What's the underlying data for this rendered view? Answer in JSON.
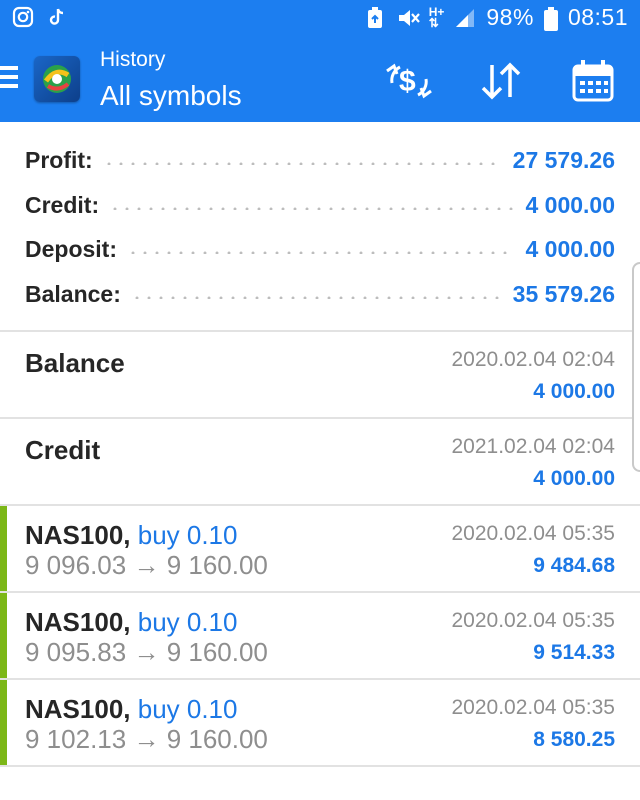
{
  "status_bar": {
    "battery_percent": "98%",
    "time": "08:51",
    "network_label": "H+"
  },
  "app_bar": {
    "title": "History",
    "subtitle": "All symbols"
  },
  "summary": {
    "rows": [
      {
        "label": "Profit:",
        "value": "27 579.26"
      },
      {
        "label": "Credit:",
        "value": "4 000.00"
      },
      {
        "label": "Deposit:",
        "value": "4 000.00"
      },
      {
        "label": "Balance:",
        "value": "35 579.26"
      }
    ]
  },
  "deals": [
    {
      "title": "Balance",
      "date": "2020.02.04 02:04",
      "amount": "4 000.00"
    },
    {
      "title": "Credit",
      "date": "2021.02.04 02:04",
      "amount": "4 000.00"
    },
    {
      "symbol": "NAS100,",
      "type": "buy 0.10",
      "open": "9 096.03",
      "arrow": "→",
      "close": "9 160.00",
      "date": "2020.02.04 05:35",
      "amount": "9 484.68"
    },
    {
      "symbol": "NAS100,",
      "type": "buy 0.10",
      "open": "9 095.83",
      "arrow": "→",
      "close": "9 160.00",
      "date": "2020.02.04 05:35",
      "amount": "9 514.33"
    },
    {
      "symbol": "NAS100,",
      "type": "buy 0.10",
      "open": "9 102.13",
      "arrow": "→",
      "close": "9 160.00",
      "date": "2020.02.04 05:35",
      "amount": "8 580.25"
    }
  ],
  "colors": {
    "primary": "#1c7ef0",
    "value_blue": "#1c78e6",
    "buy_bar_green": "#7cb718"
  }
}
